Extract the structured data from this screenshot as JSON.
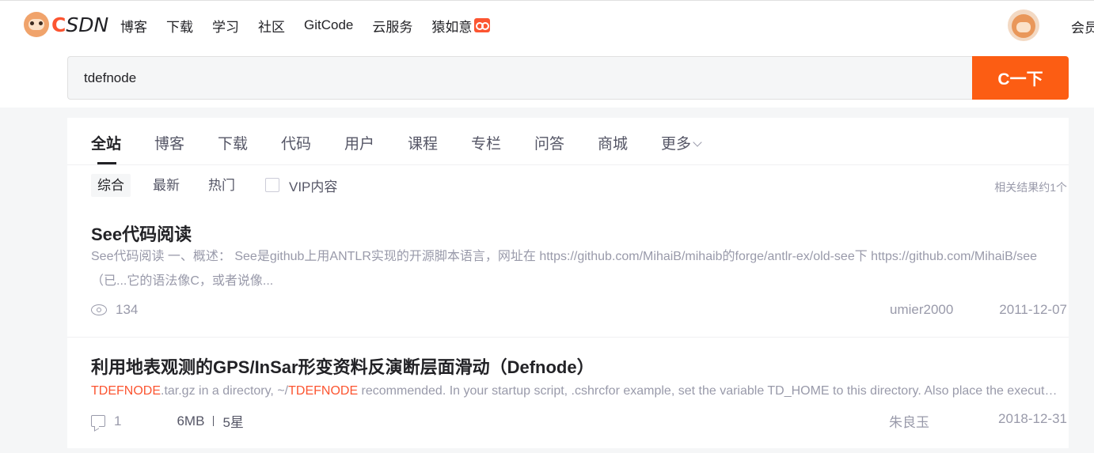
{
  "header": {
    "logo_text_c": "C",
    "logo_text_rest": "SDN",
    "nav": [
      "博客",
      "下载",
      "学习",
      "社区",
      "GitCode",
      "云服务",
      "猿如意"
    ],
    "vip_label": "会员"
  },
  "search": {
    "query": "tdefnode",
    "button_label": "C一下"
  },
  "tabs": [
    "全站",
    "博客",
    "下载",
    "代码",
    "用户",
    "课程",
    "专栏",
    "问答",
    "商城",
    "更多"
  ],
  "filters": {
    "items": [
      "综合",
      "最新",
      "热门"
    ],
    "vip_checkbox_label": "VIP内容",
    "result_count": "相关结果约1个"
  },
  "results": [
    {
      "title": "See代码阅读",
      "desc": "  See代码阅读   一、概述：  See是github上用ANTLR实现的开源脚本语言，网址在 https://github.com/MihaiB/mihaib的forge/antlr-ex/old-see下 https://github.com/MihaiB/see（已...它的语法像C，或者说像...",
      "views": "134",
      "author": "umier2000",
      "date": "2011-12-07"
    },
    {
      "title": "利用地表观测的GPS/InSar形变资料反演断层面滑动（Defnode）",
      "desc_hl1": "TDEFNODE",
      "desc_part1": ".tar.gz in a directory, ~/",
      "desc_hl2": "TDEFNODE",
      "desc_part2": " recommended. In your startup script, .cshrcfor example, set the variable TD_HOME to this directory. Also place the executable in a directory in your path.",
      "comments": "1",
      "size": "6MB",
      "stars": "5星",
      "author": "朱良玉",
      "date": "2018-12-31"
    }
  ],
  "colors": {
    "brand": "#fc5531",
    "search_button": "#fc5d13",
    "page_background": "#f5f6f7"
  }
}
